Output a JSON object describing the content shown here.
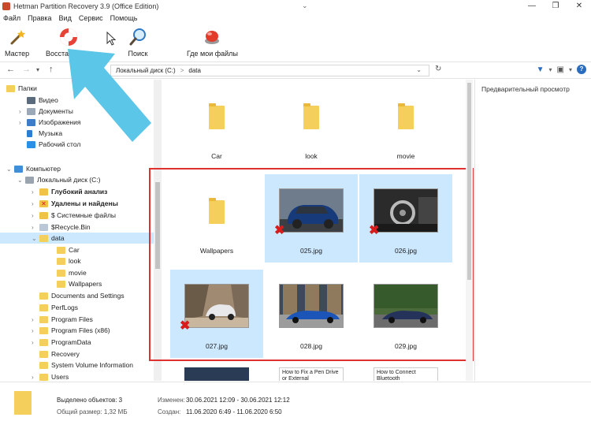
{
  "window": {
    "title": "Hetman Partition Recovery 3.9 (Office Edition)",
    "controls": [
      "—",
      "❐",
      "✕"
    ]
  },
  "menu": [
    "Файл",
    "Правка",
    "Вид",
    "Сервис",
    "Помощь"
  ],
  "toolbar": {
    "wizard": "Мастер",
    "restore": "Восстановить",
    "search": "Поиск",
    "where_files": "Где мои файлы"
  },
  "address": {
    "crumbs": [
      "Локальный диск (C:)",
      "data"
    ],
    "separator": ">"
  },
  "tree": {
    "folders_header": "Папки",
    "user_items": [
      "Видео",
      "Документы",
      "Изображения",
      "Музыка",
      "Рабочий стол"
    ],
    "computer": "Компьютер",
    "local_disk": "Локальный диск (C:)",
    "deep_analysis": "Глубокий анализ",
    "deleted_found": "Удалены и найдены",
    "system_files": "$ Системные файлы",
    "recycle": "$Recycle.Bin",
    "data": "data",
    "data_children": [
      "Car",
      "look",
      "movie",
      "Wallpapers"
    ],
    "root_items": [
      "Documents and Settings",
      "PerfLogs",
      "Program Files",
      "Program Files (x86)",
      "ProgramData",
      "Recovery",
      "System Volume Information",
      "Users"
    ]
  },
  "files": {
    "row1": [
      "Car",
      "look",
      "movie"
    ],
    "row2": [
      "Wallpapers",
      "025.jpg",
      "026.jpg"
    ],
    "row3": [
      "027.jpg",
      "028.jpg",
      "029.jpg"
    ],
    "row4_partial": [
      "How to Fix a Pen Drive or External",
      "How to Connect Bluetooth"
    ]
  },
  "preview": {
    "title": "Предварительный просмотр"
  },
  "status": {
    "selected_label": "Выделено объектов: 3",
    "total_size": "Общий размер: 1,32 МБ",
    "modified_label": "Изменен:",
    "modified_value": "30.06.2021 12:09 - 30.06.2021 12:12",
    "created_label": "Создан:",
    "created_value": "11.06.2020 6:49 - 11.06.2020 6:50"
  },
  "colors": {
    "selection": "#cce8ff",
    "highlight_box": "#e0302f",
    "arrow": "#5bc6e8",
    "folder": "#f5cf5b",
    "deleted_mark": "#d81b1b"
  }
}
